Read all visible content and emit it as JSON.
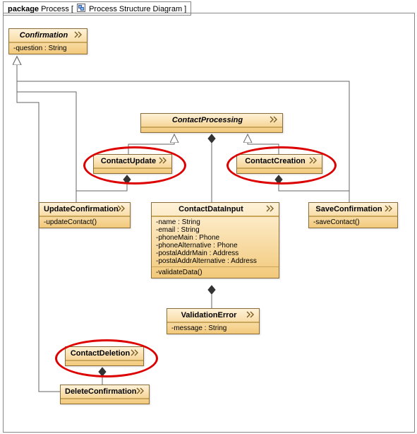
{
  "package": {
    "keyword": "package",
    "name": "Process",
    "diagramType": "Process Structure Diagram"
  },
  "classes": {
    "Confirmation": {
      "title": "Confirmation",
      "abstract": true,
      "attrs": [
        "-question : String"
      ],
      "ops": []
    },
    "ContactProcessing": {
      "title": "ContactProcessing",
      "abstract": true,
      "attrs": [],
      "ops": []
    },
    "ContactUpdate": {
      "title": "ContactUpdate",
      "abstract": false,
      "attrs": [],
      "ops": []
    },
    "ContactCreation": {
      "title": "ContactCreation",
      "abstract": false,
      "attrs": [],
      "ops": []
    },
    "UpdateConfirmation": {
      "title": "UpdateConfirmation",
      "abstract": false,
      "attrs": [],
      "ops": [
        "-updateContact()"
      ]
    },
    "ContactDataInput": {
      "title": "ContactDataInput",
      "abstract": false,
      "attrs": [
        "-name : String",
        "-email : String",
        "-phoneMain : Phone",
        "-phoneAlternative : Phone",
        "-postalAddrMain : Address",
        "-postalAddrAlternative : Address"
      ],
      "ops": [
        "-validateData()"
      ]
    },
    "SaveConfirmation": {
      "title": "SaveConfirmation",
      "abstract": false,
      "attrs": [],
      "ops": [
        "-saveContact()"
      ]
    },
    "ValidationError": {
      "title": "ValidationError",
      "abstract": false,
      "attrs": [
        "-message : String"
      ],
      "ops": []
    },
    "ContactDeletion": {
      "title": "ContactDeletion",
      "abstract": false,
      "attrs": [],
      "ops": []
    },
    "DeleteConfirmation": {
      "title": "DeleteConfirmation",
      "abstract": false,
      "attrs": [],
      "ops": []
    }
  },
  "highlighted": [
    "ContactUpdate",
    "ContactCreation",
    "ContactDeletion"
  ],
  "relationships": [
    {
      "kind": "generalization",
      "child": "ContactUpdate",
      "parent": "ContactProcessing"
    },
    {
      "kind": "generalization",
      "child": "ContactCreation",
      "parent": "ContactProcessing"
    },
    {
      "kind": "generalization",
      "child": "UpdateConfirmation",
      "parent": "Confirmation"
    },
    {
      "kind": "generalization",
      "child": "SaveConfirmation",
      "parent": "Confirmation"
    },
    {
      "kind": "generalization",
      "child": "DeleteConfirmation",
      "parent": "Confirmation"
    },
    {
      "kind": "composition",
      "whole": "ContactUpdate",
      "part": "UpdateConfirmation"
    },
    {
      "kind": "composition",
      "whole": "ContactCreation",
      "part": "SaveConfirmation"
    },
    {
      "kind": "composition",
      "whole": "ContactProcessing",
      "part": "ContactDataInput"
    },
    {
      "kind": "composition",
      "whole": "ContactDataInput",
      "part": "ValidationError"
    },
    {
      "kind": "composition",
      "whole": "ContactDeletion",
      "part": "DeleteConfirmation"
    }
  ],
  "chart_data": {
    "type": "table",
    "note": "UML-style process structure diagram inside a 'Process' package.",
    "nodes": [
      {
        "id": "Confirmation",
        "stereotype": "abstract",
        "attributes": [
          "question : String"
        ]
      },
      {
        "id": "ContactProcessing",
        "stereotype": "abstract"
      },
      {
        "id": "ContactUpdate",
        "highlighted": true
      },
      {
        "id": "ContactCreation",
        "highlighted": true
      },
      {
        "id": "UpdateConfirmation",
        "operations": [
          "updateContact()"
        ]
      },
      {
        "id": "ContactDataInput",
        "attributes": [
          "name : String",
          "email : String",
          "phoneMain : Phone",
          "phoneAlternative : Phone",
          "postalAddrMain : Address",
          "postalAddrAlternative : Address"
        ],
        "operations": [
          "validateData()"
        ]
      },
      {
        "id": "SaveConfirmation",
        "operations": [
          "saveContact()"
        ]
      },
      {
        "id": "ValidationError",
        "attributes": [
          "message : String"
        ]
      },
      {
        "id": "ContactDeletion",
        "highlighted": true
      },
      {
        "id": "DeleteConfirmation"
      }
    ],
    "edges": [
      {
        "kind": "generalization",
        "from": "ContactUpdate",
        "to": "ContactProcessing"
      },
      {
        "kind": "generalization",
        "from": "ContactCreation",
        "to": "ContactProcessing"
      },
      {
        "kind": "generalization",
        "from": "UpdateConfirmation",
        "to": "Confirmation"
      },
      {
        "kind": "generalization",
        "from": "SaveConfirmation",
        "to": "Confirmation"
      },
      {
        "kind": "generalization",
        "from": "DeleteConfirmation",
        "to": "Confirmation"
      },
      {
        "kind": "composition",
        "from": "ContactUpdate",
        "to": "UpdateConfirmation"
      },
      {
        "kind": "composition",
        "from": "ContactCreation",
        "to": "SaveConfirmation"
      },
      {
        "kind": "composition",
        "from": "ContactProcessing",
        "to": "ContactDataInput"
      },
      {
        "kind": "composition",
        "from": "ContactDataInput",
        "to": "ValidationError"
      },
      {
        "kind": "composition",
        "from": "ContactDeletion",
        "to": "DeleteConfirmation"
      }
    ]
  }
}
